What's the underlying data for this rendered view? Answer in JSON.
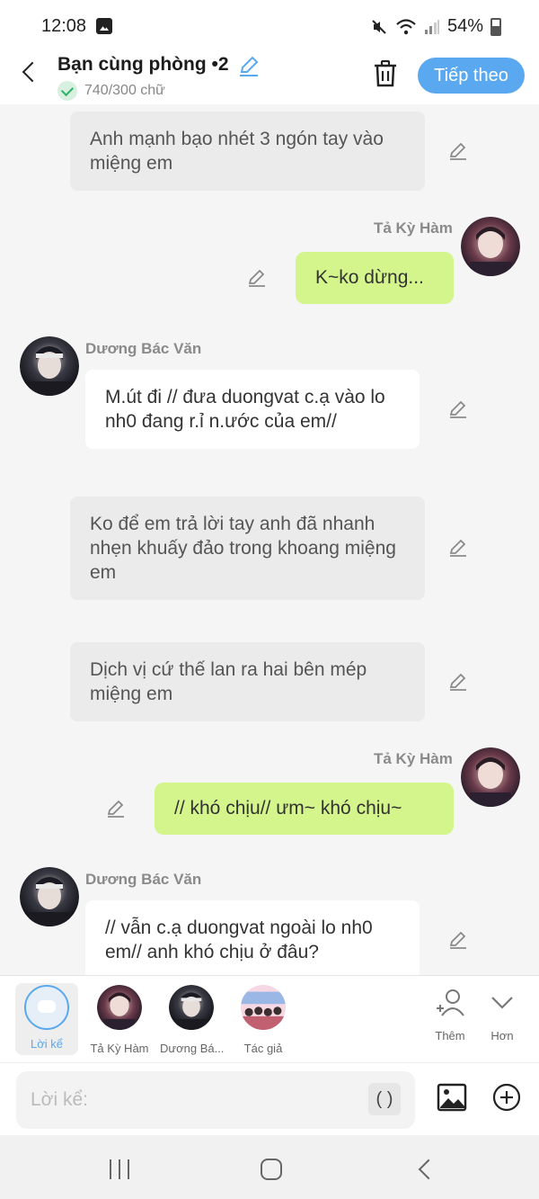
{
  "status_bar": {
    "time": "12:08",
    "battery": "54%"
  },
  "header": {
    "title": "Bạn cùng phòng •2",
    "word_count": "740/300 chữ",
    "next_label": "Tiếp theo"
  },
  "messages": [
    {
      "type": "narration",
      "text": "Anh mạnh bạo nhét 3 ngón tay vào miệng em"
    },
    {
      "type": "right",
      "sender": "Tả Kỳ Hàm",
      "text": "K~ko dừng..."
    },
    {
      "type": "left",
      "sender": "Dương Bác Văn",
      "text": "M.út đi // đưa duongvat c.ạ vào lo nh0 đang r.ỉ n.ước của em//"
    },
    {
      "type": "narration",
      "text": "Ko để em trả lời tay anh đã nhanh nhẹn khuấy đảo trong khoang miệng em"
    },
    {
      "type": "narration",
      "text": "Dịch vị cứ thế lan ra hai bên mép miệng em"
    },
    {
      "type": "right",
      "sender": "Tả Kỳ Hàm",
      "text": "// khó chịu// ưm~ khó chịu~"
    },
    {
      "type": "left",
      "sender": "Dương Bác Văn",
      "text": "// vẫn c.ạ duongvat ngoài lo nh0 em// anh khó chịu ở đâu?"
    }
  ],
  "characters": [
    {
      "label": "Lời kể"
    },
    {
      "label": "Tả Kỳ Hàm"
    },
    {
      "label": "Dương Bá..."
    },
    {
      "label": "Tác giả"
    }
  ],
  "char_actions": {
    "add_label": "Thêm",
    "more_label": "Hơn"
  },
  "input": {
    "placeholder": "Lời kể:",
    "paren_label": "( )"
  },
  "colors": {
    "accent": "#5aa8ef",
    "right_bubble": "#d4f58c",
    "narration_bg": "#ebebeb"
  }
}
